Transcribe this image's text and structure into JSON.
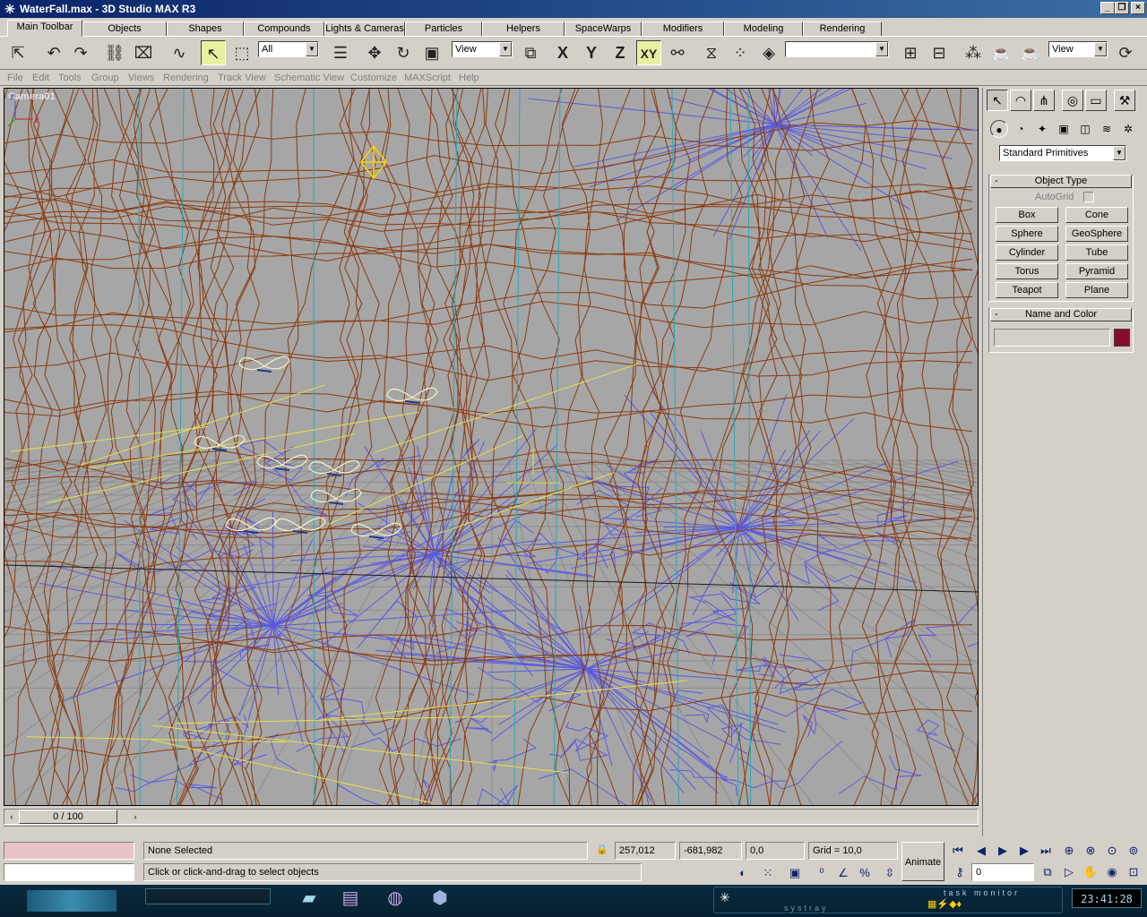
{
  "window": {
    "title": "WaterFall.max - 3D Studio MAX R3",
    "minimize": "_",
    "restore": "❐",
    "close": "×"
  },
  "tabs": [
    "Main Toolbar",
    "Objects",
    "Shapes",
    "Compounds",
    "Lights & Cameras",
    "Particles",
    "Helpers",
    "SpaceWarps",
    "Modifiers",
    "Modeling",
    "Rendering"
  ],
  "toolbar": {
    "selection_filter": "All",
    "reference_coord": "View",
    "axis_x": "X",
    "axis_y": "Y",
    "axis_z": "Z",
    "axis_xy": "XY",
    "named_selection": "",
    "render_type": "View"
  },
  "menus": [
    "File",
    "Edit",
    "Tools",
    "Group",
    "Views",
    "Rendering",
    "Track View",
    "Schematic View",
    "Customize",
    "MAXScript",
    "Help"
  ],
  "viewport": {
    "label": "Camera01",
    "axis_z": "z",
    "axis_x": "x"
  },
  "command_panel": {
    "category": "Standard Primitives",
    "object_type_title": "Object Type",
    "autogrid_label": "AutoGrid",
    "object_buttons": [
      "Box",
      "Cone",
      "Sphere",
      "GeoSphere",
      "Cylinder",
      "Tube",
      "Torus",
      "Pyramid",
      "Teapot",
      "Plane"
    ],
    "name_color_title": "Name and Color",
    "object_name": "",
    "color": "#8b0a2a"
  },
  "time_slider": {
    "frame": "0 / 100"
  },
  "status": {
    "selection": "None Selected",
    "prompt": "Click or click-and-drag to select objects",
    "coord_x": "257,012",
    "coord_y": "-681,982",
    "coord_z": "0,0",
    "grid": "Grid = 10,0",
    "animate": "Animate",
    "current_frame": "0"
  },
  "taskbar": {
    "task_monitor": "task monitor",
    "systray": "systray",
    "clock": "23:41:28"
  }
}
